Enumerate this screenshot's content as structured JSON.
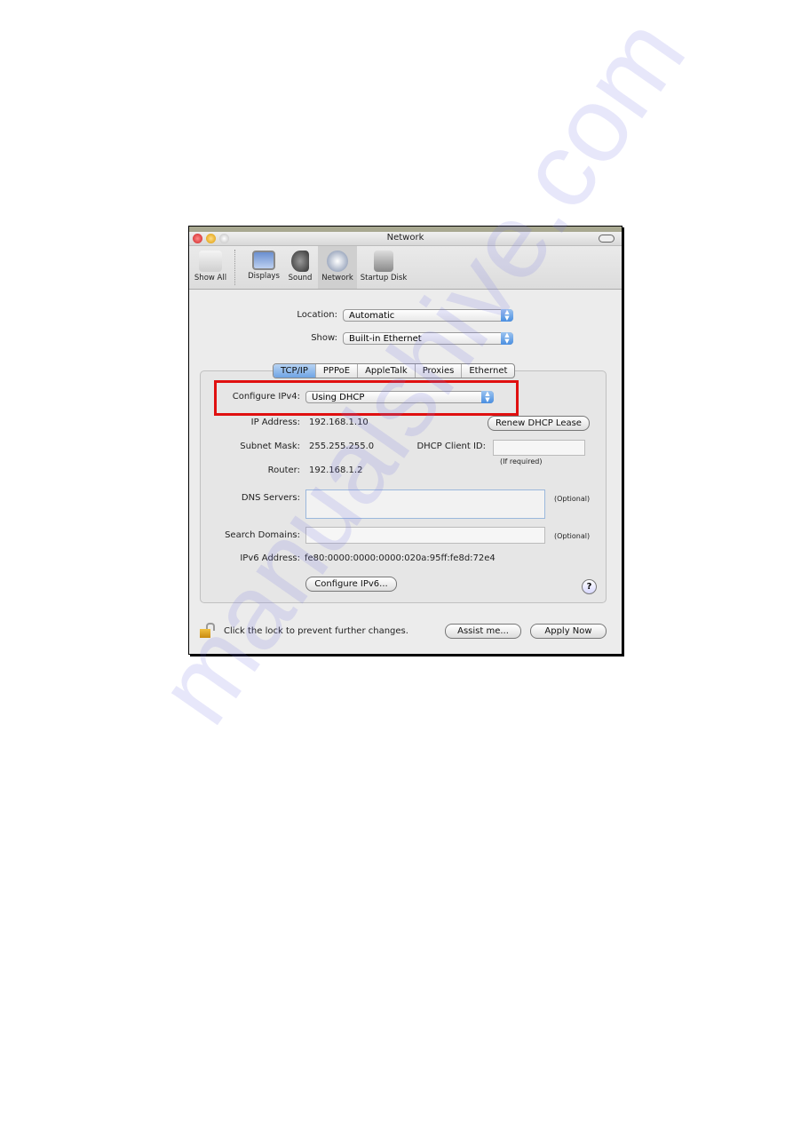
{
  "window": {
    "title": "Network"
  },
  "toolbar": {
    "items": [
      {
        "label": "Show All",
        "icon": "apple-icon"
      },
      {
        "label": "Displays",
        "icon": "display-icon"
      },
      {
        "label": "Sound",
        "icon": "speaker-icon"
      },
      {
        "label": "Network",
        "icon": "globe-icon",
        "selected": true
      },
      {
        "label": "Startup Disk",
        "icon": "disk-icon"
      }
    ]
  },
  "location": {
    "label": "Location:",
    "value": "Automatic"
  },
  "show": {
    "label": "Show:",
    "value": "Built-in Ethernet"
  },
  "tabs": [
    "TCP/IP",
    "PPPoE",
    "AppleTalk",
    "Proxies",
    "Ethernet"
  ],
  "tcpip": {
    "configure_label": "Configure IPv4:",
    "configure_value": "Using DHCP",
    "ip_label": "IP Address:",
    "ip_value": "192.168.1.10",
    "renew_button": "Renew DHCP Lease",
    "subnet_label": "Subnet Mask:",
    "subnet_value": "255.255.255.0",
    "client_id_label": "DHCP Client ID:",
    "client_id_value": "",
    "client_id_hint": "(If required)",
    "router_label": "Router:",
    "router_value": "192.168.1.2",
    "dns_label": "DNS Servers:",
    "dns_value": "",
    "dns_hint": "(Optional)",
    "search_label": "Search Domains:",
    "search_value": "",
    "search_hint": "(Optional)",
    "ipv6_label": "IPv6 Address:",
    "ipv6_value": "fe80:0000:0000:0000:020a:95ff:fe8d:72e4",
    "configure_ipv6_button": "Configure IPv6...",
    "help": "?"
  },
  "footer": {
    "lock_text": "Click the lock to prevent further changes.",
    "assist_button": "Assist me...",
    "apply_button": "Apply Now"
  },
  "highlight_color": "#e01010",
  "watermark": "manualshive.com"
}
